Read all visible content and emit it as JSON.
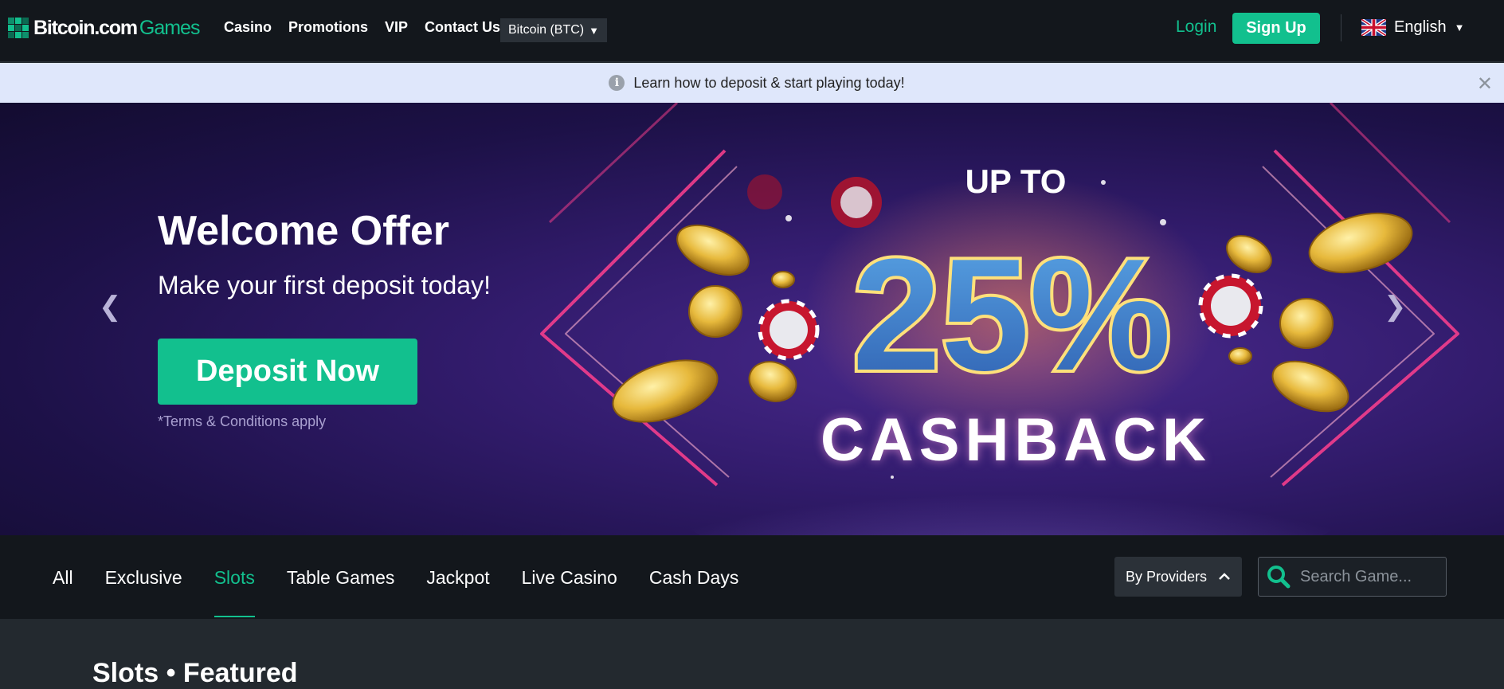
{
  "brand": {
    "name_a": "Bitcoin.com",
    "name_b": "Games",
    "accent": "#12c08e"
  },
  "nav": {
    "links": [
      "Casino",
      "Promotions",
      "VIP",
      "Contact Us"
    ],
    "currency": "Bitcoin (BTC)",
    "login": "Login",
    "signup": "Sign Up",
    "language": "English"
  },
  "infobar": {
    "text": "Learn how to deposit & start playing today!",
    "icon": "info-icon",
    "close": "✕"
  },
  "hero": {
    "title": "Welcome Offer",
    "subtitle": "Make your first deposit today!",
    "cta": "Deposit Now",
    "terms": "*Terms & Conditions apply",
    "promo_top": "UP TO",
    "promo_value": "25%",
    "promo_bottom": "CASHBACK",
    "prev_icon": "chevron-left-icon",
    "next_icon": "chevron-right-icon"
  },
  "categories": {
    "items": [
      "All",
      "Exclusive",
      "Slots",
      "Table Games",
      "Jackpot",
      "Live Casino",
      "Cash Days"
    ],
    "active": "Slots",
    "providers_label": "By Providers",
    "search_placeholder": "Search Game..."
  },
  "section": {
    "title": "Slots • Featured"
  }
}
